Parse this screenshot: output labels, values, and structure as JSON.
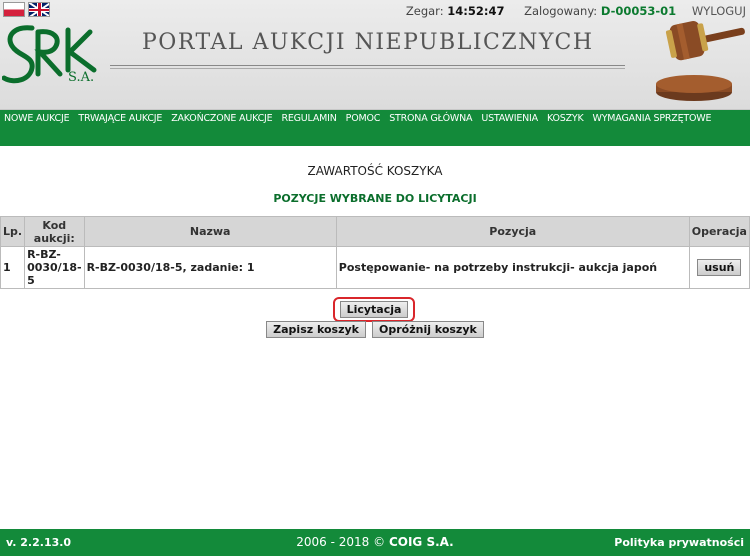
{
  "header": {
    "clock_label": "Zegar:",
    "clock_value": "14:52:47",
    "logged_label": "Zalogowany:",
    "logged_user": "D-00053-01",
    "logout_label": "WYLOGUJ",
    "banner_title": "PORTAL AUKCJI NIEPUBLICZNYCH",
    "logo_suffix": "S.A.",
    "flags": [
      "flag-pl-icon",
      "flag-uk-icon"
    ]
  },
  "nav": {
    "items": [
      "NOWE AUKCJE",
      "TRWAJĄCE AUKCJE",
      "ZAKOŃCZONE AUKCJE",
      "REGULAMIN",
      "POMOC",
      "STRONA GŁÓWNA",
      "USTAWIENIA",
      "KOSZYK",
      "WYMAGANIA SPRZĘTOWE"
    ]
  },
  "content": {
    "page_title": "ZAWARTOŚĆ KOSZYKA",
    "section_title": "POZYCJE WYBRANE DO LICYTACJI",
    "table": {
      "headers": [
        "Lp.",
        "Kod aukcji:",
        "Nazwa",
        "Pozycja",
        "Operacja"
      ],
      "rows": [
        {
          "lp": "1",
          "kod": "R-BZ-0030/18-5",
          "nazwa": "R-BZ-0030/18-5, zadanie: 1",
          "pozycja": "Postępowanie- na potrzeby instrukcji- aukcja japoń",
          "operacja": "usuń"
        }
      ]
    },
    "buttons": {
      "licytacja": "Licytacja",
      "zapisz": "Zapisz koszyk",
      "oproznij": "Opróżnij koszyk"
    }
  },
  "footer": {
    "version": "v. 2.2.13.0",
    "copyright_years": "2006 - 2018 ©",
    "copyright_owner": "COIG S.A.",
    "privacy": "Polityka prywatności"
  },
  "colors": {
    "brand_green": "#138a3a",
    "accent_green_text": "#0b7a2f",
    "highlight_red": "#d9262b"
  }
}
